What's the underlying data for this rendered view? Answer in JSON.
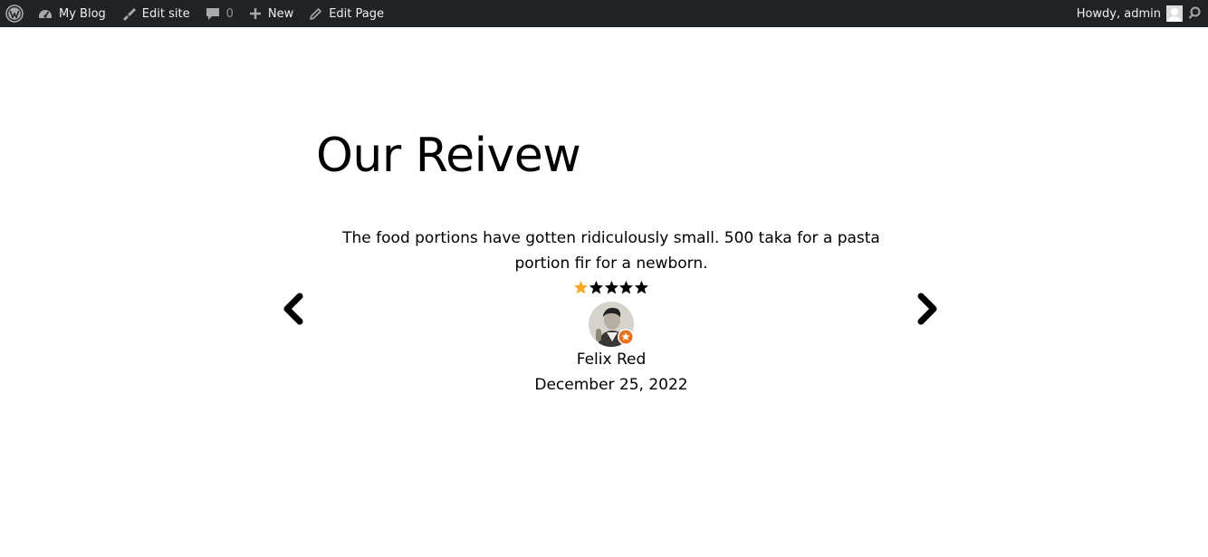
{
  "admin_bar": {
    "wp_logo_icon": "wordpress-logo-icon",
    "site_name": "My Blog",
    "edit_site": "Edit site",
    "comments_count": "0",
    "new_label": "New",
    "edit_page": "Edit Page",
    "howdy": "Howdy, admin",
    "background_color": "#1d2327",
    "text_color": "#f0f0f1"
  },
  "section": {
    "title": "Our Reivew"
  },
  "review": {
    "text": "The food portions have gotten ridiculously small. 500 taka for a pasta portion fir for a newborn.",
    "rating": 1,
    "max_rating": 5,
    "star_filled_color": "#f5a623",
    "star_empty_color": "#000000",
    "badge_color": "#e8711c",
    "reviewer_name": "Felix Red",
    "date": "December 25, 2022"
  },
  "carousel": {
    "prev_icon": "chevron-left-icon",
    "next_icon": "chevron-right-icon"
  }
}
